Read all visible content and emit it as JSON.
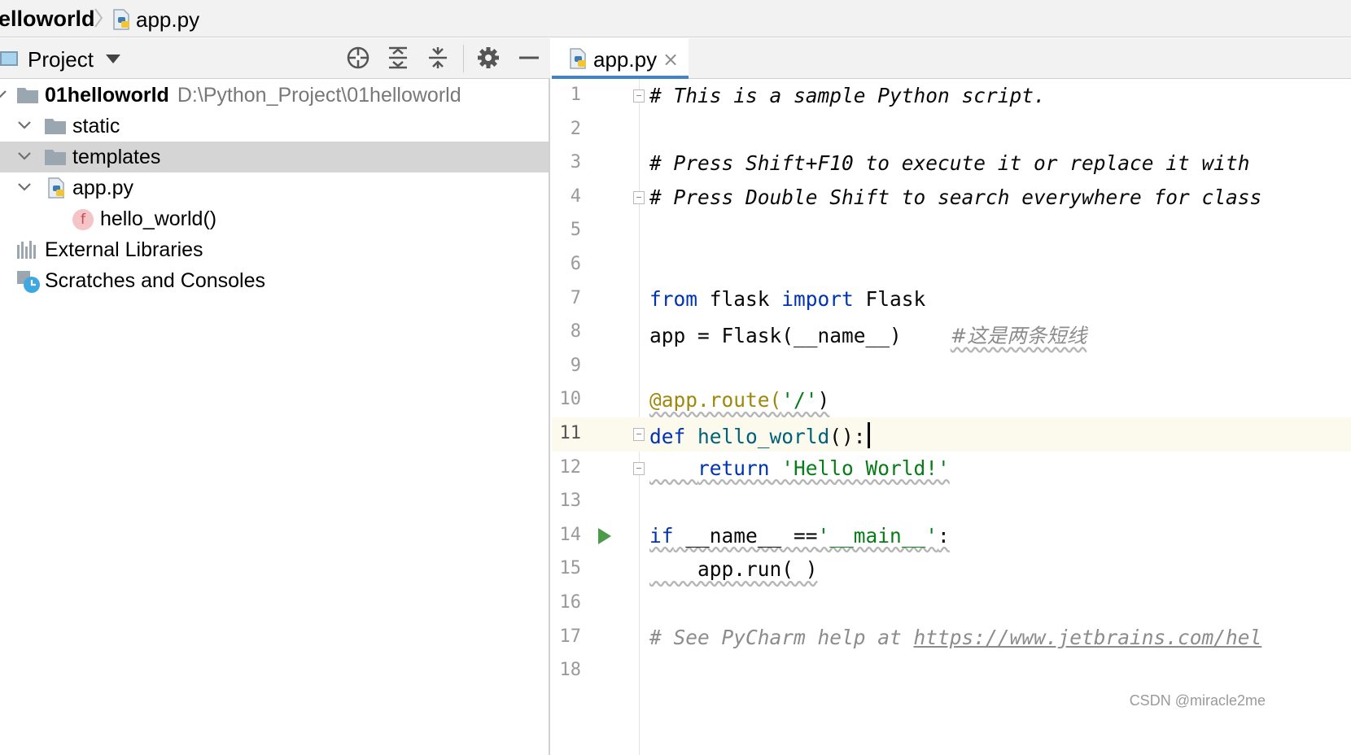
{
  "breadcrumb": {
    "project": "elloworld",
    "file": "app.py"
  },
  "project_panel": {
    "title": "Project",
    "toolbar": [
      "locate-icon",
      "expand-all-icon",
      "collapse-all-icon",
      "gear-icon",
      "hide-icon"
    ],
    "tree": {
      "root": {
        "name": "01helloworld",
        "path": "D:\\Python_Project\\01helloworld"
      },
      "static": "static",
      "templates": "templates",
      "app_py": "app.py",
      "hello_world": "hello_world()",
      "function_badge": "f",
      "external_libraries": "External Libraries",
      "scratches": "Scratches and Consoles"
    }
  },
  "editor": {
    "tab": {
      "label": "app.py",
      "close": "×"
    },
    "lines": {
      "n": [
        "1",
        "2",
        "3",
        "4",
        "5",
        "6",
        "7",
        "8",
        "9",
        "10",
        "11",
        "12",
        "13",
        "14",
        "15",
        "16",
        "17",
        "18"
      ],
      "l1": "# This is a sample Python script.",
      "l3": "# Press Shift+F10 to execute it or replace it with",
      "l4": "# Press Double Shift to search everywhere for class",
      "l7": {
        "kw_from": "from",
        "mod": " flask ",
        "kw_import": "import",
        "cls": " Flask"
      },
      "l8": {
        "code": "app = Flask(__name__)",
        "comment": "#这是两条短线"
      },
      "l10": {
        "deco": "@app.route(",
        "str": "'/'",
        "close": ")"
      },
      "l11": {
        "kw": "def",
        "fn": "hello_world",
        "rest": "():"
      },
      "l12": {
        "indent": "    ",
        "kw": "return",
        "str": " 'Hello World!'"
      },
      "l14": {
        "kw": "if",
        "name": " __name__ ==",
        "str": "'__main__'",
        "colon": ":"
      },
      "l15": {
        "code": "    app.run( )"
      },
      "l17": {
        "comment": "# See PyCharm help at ",
        "link": "https://www.jetbrains.com/hel"
      }
    }
  },
  "watermark": "CSDN @miracle2me",
  "colors": {
    "keyword": "#0033b3",
    "string": "#067d17",
    "comment": "#8c8c8c",
    "decorator": "#9e880d",
    "selection": "#d5d5d5",
    "accent": "#4083c9"
  }
}
